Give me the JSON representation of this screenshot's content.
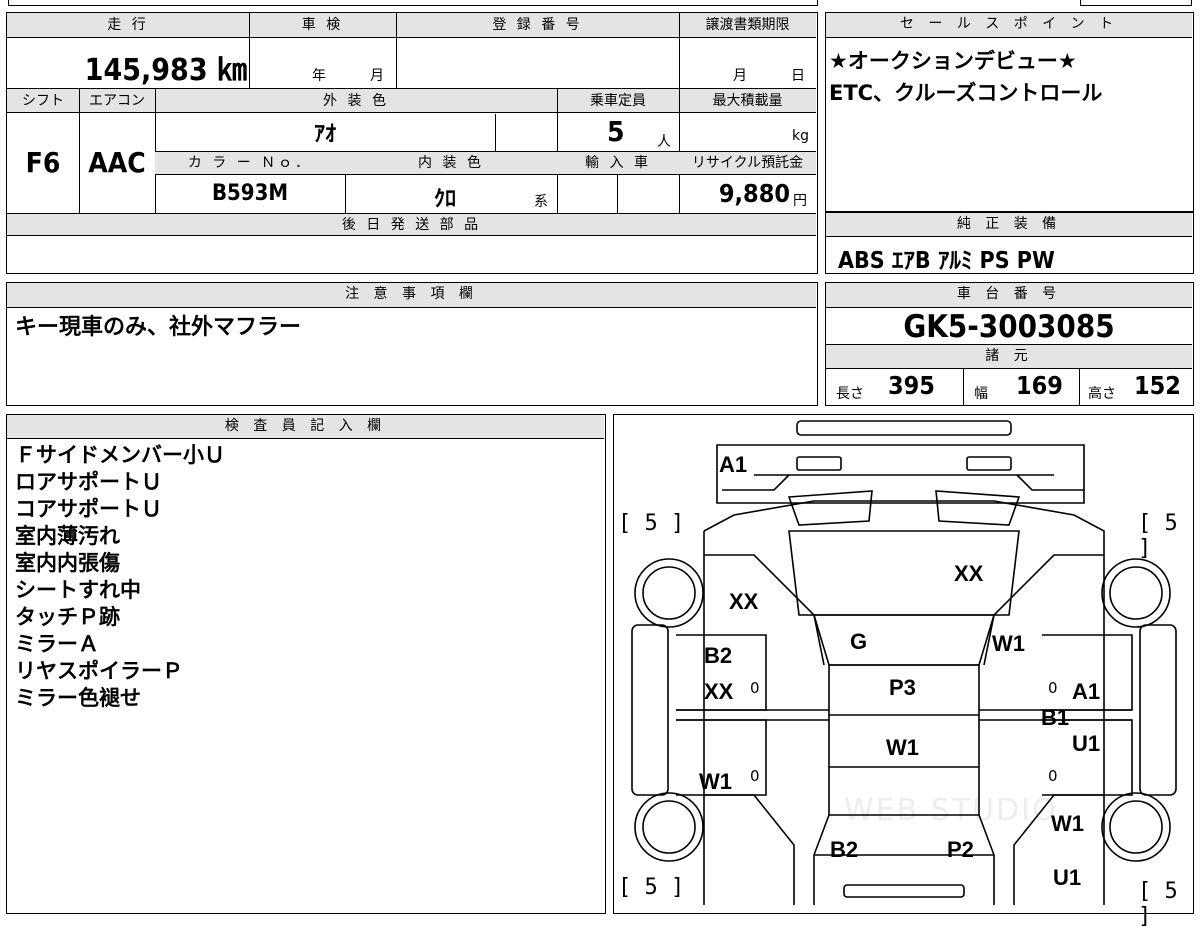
{
  "mileage": {
    "label": "走 行",
    "value": "145,983 ㎞"
  },
  "inspection": {
    "label": "車 検",
    "year": "年",
    "month": "月"
  },
  "registration": {
    "label": "登 録 番 号",
    "value": ""
  },
  "transfer": {
    "label": "譲渡書類期限",
    "month": "月",
    "day": "日"
  },
  "sales_points": {
    "label": "セ ー ル ス ポ イ ン ト",
    "lines": [
      "★オークションデビュー★",
      "ETC、クルーズコントロール"
    ]
  },
  "shift": {
    "label": "シフト",
    "value": "F6"
  },
  "aircon": {
    "label": "エアコン",
    "value": "AAC"
  },
  "exterior_color": {
    "label": "外 装 色",
    "value": "ｱｵ"
  },
  "capacity": {
    "label": "乗車定員",
    "value": "5",
    "unit": "人"
  },
  "max_load": {
    "label": "最大積載量",
    "unit": "kg"
  },
  "color_no": {
    "label": "カ ラ ー Ｎｏ．",
    "value": "B593M"
  },
  "interior_color": {
    "label": "内 装 色",
    "value": "ｸﾛ",
    "suffix": "系"
  },
  "import": {
    "label": "輸 入 車"
  },
  "recycle": {
    "label": "リサイクル預託金",
    "value": "9,880",
    "unit": "円"
  },
  "later_parts": {
    "label": "後 日 発 送 部 品"
  },
  "equipment": {
    "label": "純 正 装 備",
    "value": "ABS ｴｱB ｱﾙﾐ PS PW"
  },
  "notes": {
    "label": "注 意 事 項 欄",
    "value": "キー現車のみ、社外マフラー"
  },
  "chassis": {
    "label": "車 台 番 号",
    "value": "GK5-3003085"
  },
  "specs": {
    "label": "諸 元",
    "length_label": "長さ",
    "length": "395",
    "width_label": "幅",
    "width": "169",
    "height_label": "高さ",
    "height": "152"
  },
  "inspector": {
    "label": "検 査 員 記 入 欄",
    "lines": [
      "Ｆサイドメンバー小Ｕ",
      "ロアサポートＵ",
      "コアサポートＵ",
      "室内薄汚れ",
      "室内内張傷",
      "シートすれ中",
      "タッチＰ跡",
      "ミラーＡ",
      "リヤスポイラーＰ",
      "ミラー色褪せ"
    ]
  },
  "diagram": {
    "tires": {
      "fl": "[ 5 ]",
      "fr": "[ 5 ]",
      "rl": "[ 5 ]",
      "rr": "[ 5 ]"
    },
    "marks": {
      "front_bumper": "A1",
      "hood": "XX",
      "left_fender": "XX",
      "windshield": "G",
      "right_pillar": "W1",
      "left_front_door_1": "B2",
      "left_front_door_2": "XX",
      "roof": "P3",
      "right_front_door_1": "A1",
      "right_front_door_2": "B1",
      "right_rear_door": "U1",
      "roof_rear": "W1",
      "left_rear_door": "W1",
      "right_quarter": "W1",
      "rear_left": "B2",
      "rear_right": "P2",
      "right_rear_quarter": "U1"
    },
    "zero": "0",
    "watermark": "WEB STUDIO"
  }
}
